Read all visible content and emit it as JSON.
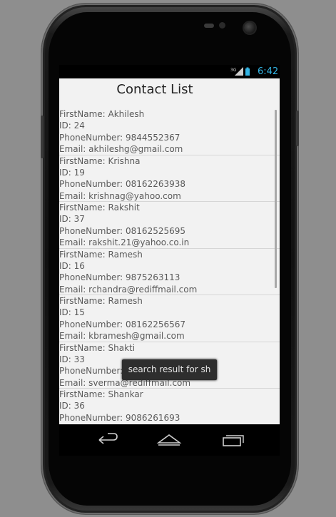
{
  "status_bar": {
    "network": "3G",
    "time": "6:42"
  },
  "app": {
    "title": "Contact List"
  },
  "contacts": [
    {
      "first_name": "FirstName: Akhilesh",
      "id": "ID: 24",
      "phone": "PhoneNumber: 9844552367",
      "email": "Email: akhileshg@gmail.com"
    },
    {
      "first_name": "FirstName: Krishna",
      "id": "ID: 19",
      "phone": "PhoneNumber: 08162263938",
      "email": "Email: krishnag@yahoo.com"
    },
    {
      "first_name": "FirstName: Rakshit",
      "id": "ID: 37",
      "phone": "PhoneNumber: 08162525695",
      "email": "Email: rakshit.21@yahoo.co.in"
    },
    {
      "first_name": "FirstName: Ramesh",
      "id": "ID: 16",
      "phone": "PhoneNumber: 9875263113",
      "email": "Email: rchandra@rediffmail.com"
    },
    {
      "first_name": "FirstName: Ramesh",
      "id": "ID: 15",
      "phone": "PhoneNumber: 08162256567",
      "email": "Email: kbramesh@gmail.com"
    },
    {
      "first_name": "FirstName: Shakti",
      "id": "ID: 33",
      "phone": "PhoneNumber: 9",
      "email": "Email: sverma@rediffmail.com"
    },
    {
      "first_name": "FirstName: Shankar",
      "id": "ID: 36",
      "phone": "PhoneNumber: 9086261693",
      "email": ""
    }
  ],
  "toast": {
    "text": "search result for sh"
  },
  "nav": {
    "back_icon": "back-icon",
    "home_icon": "home-icon",
    "recents_icon": "recents-icon"
  },
  "colors": {
    "status_time": "#33b5e5",
    "screen_bg": "#f2f2f2",
    "toast_bg": "#2e2e2e"
  }
}
